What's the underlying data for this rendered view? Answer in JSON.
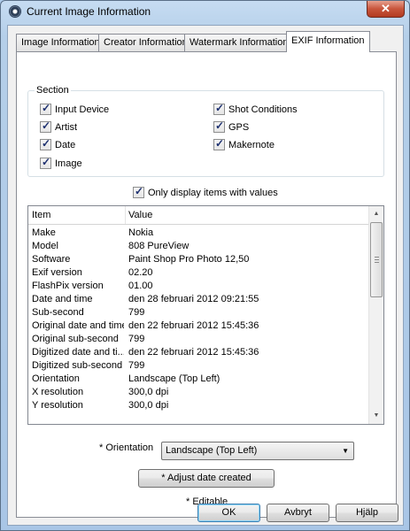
{
  "window": {
    "title": "Current Image Information",
    "close_glyph": "✕"
  },
  "tabs": [
    {
      "label": "Image Information"
    },
    {
      "label": "Creator Information"
    },
    {
      "label": "Watermark Information"
    },
    {
      "label": "EXIF Information"
    }
  ],
  "section": {
    "legend": "Section",
    "checkboxes": [
      {
        "label": "Input Device",
        "checked": true
      },
      {
        "label": "Artist",
        "checked": true
      },
      {
        "label": "Date",
        "checked": true
      },
      {
        "label": "Image",
        "checked": true
      },
      {
        "label": "Shot Conditions",
        "checked": true
      },
      {
        "label": "GPS",
        "checked": true
      },
      {
        "label": "Makernote",
        "checked": true
      }
    ]
  },
  "only_values": {
    "label": "Only display items with values",
    "checked": true
  },
  "table": {
    "col_item": "Item",
    "col_value": "Value",
    "rows": [
      {
        "item": "Make",
        "value": "Nokia"
      },
      {
        "item": "Model",
        "value": "808 PureView"
      },
      {
        "item": "Software",
        "value": "Paint Shop Pro Photo 12,50"
      },
      {
        "item": "Exif version",
        "value": "02.20"
      },
      {
        "item": "FlashPix version",
        "value": "01.00"
      },
      {
        "item": "Date and time",
        "value": "den 28 februari 2012 09:21:55"
      },
      {
        "item": "Sub-second",
        "value": "799"
      },
      {
        "item": "Original date and time",
        "value": "den 22 februari 2012 15:45:36"
      },
      {
        "item": "Original sub-second",
        "value": "799"
      },
      {
        "item": "Digitized date and ti...",
        "value": "den 22 februari 2012 15:45:36"
      },
      {
        "item": "Digitized sub-second",
        "value": "799"
      },
      {
        "item": "Orientation",
        "value": "Landscape (Top Left)"
      },
      {
        "item": "X resolution",
        "value": "300,0 dpi"
      },
      {
        "item": "Y resolution",
        "value": "300,0 dpi"
      }
    ]
  },
  "orientation": {
    "label": "* Orientation",
    "selected": "Landscape (Top Left)"
  },
  "adjust_button": "* Adjust date created",
  "editable_note": "* Editable",
  "footer": {
    "ok": "OK",
    "cancel": "Avbryt",
    "help": "Hjälp"
  }
}
